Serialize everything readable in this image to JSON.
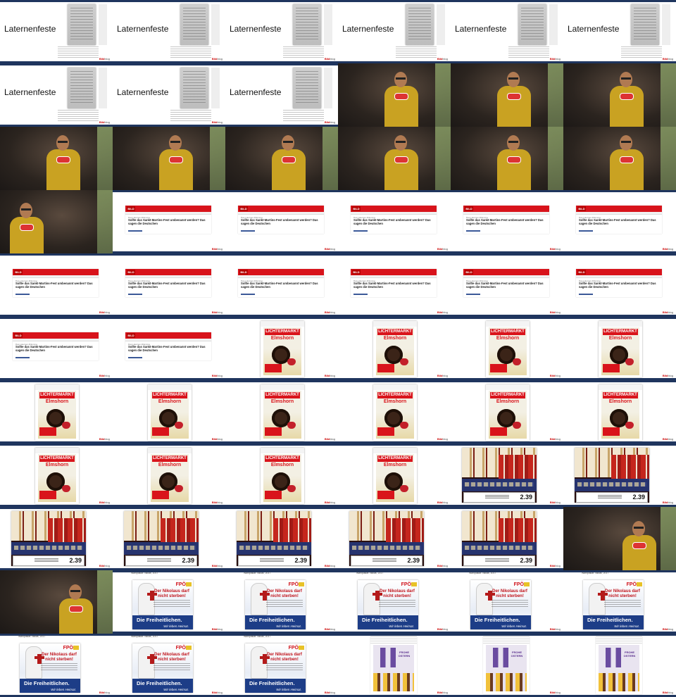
{
  "slide_title": "Laternenfeste",
  "logo": {
    "mark": "Bild",
    "suffix": "blog"
  },
  "bild_site": {
    "brand": "BILD",
    "kicker": "Das Laternen-Dilemma",
    "headline": "Sollte das Sankt-Martins-Fest umbenannt werden? Das sagen die Deutschen"
  },
  "lichtermarkt_poster": {
    "line1": "LICHTERMARKT",
    "line2": "Elmshorn"
  },
  "chocolate_price": "2.39",
  "fpo_poster": {
    "note": "Wahlplakat: Niklas, 2017",
    "party": "FPÖ",
    "headline": "Der Nikolaus darf nicht sterben!",
    "footer_main": "Die Freiheitlichen.",
    "footer_sub": "Wir leben Heimat."
  },
  "easter_sign": "FROHE OSTERN",
  "cells": [
    "title",
    "title",
    "title",
    "title",
    "title",
    "title",
    "title",
    "title",
    "title",
    "speaker",
    "speaker",
    "speaker",
    "speaker",
    "speaker",
    "speaker",
    "speaker",
    "speaker",
    "speaker",
    "speaker-close",
    "web",
    "web",
    "web",
    "web",
    "web",
    "web",
    "web",
    "web",
    "web",
    "web",
    "web",
    "web",
    "web",
    "poster",
    "poster",
    "poster",
    "poster",
    "poster",
    "poster",
    "poster",
    "poster",
    "poster",
    "poster",
    "poster",
    "poster",
    "poster",
    "poster",
    "choc",
    "choc",
    "choc",
    "choc",
    "choc",
    "choc",
    "choc",
    "speaker-side",
    "speaker-side",
    "fpo",
    "fpo",
    "fpo",
    "fpo",
    "fpo",
    "fpo",
    "fpo",
    "fpo",
    "bunny",
    "bunny",
    "bunny"
  ]
}
